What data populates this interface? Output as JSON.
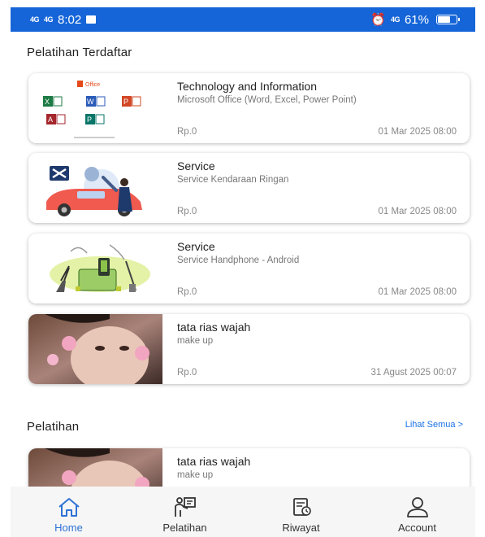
{
  "status": {
    "network1": "4G",
    "network2": "4G",
    "time": "8:02",
    "network3": "4G",
    "battery": "61%",
    "battery_level": 0.61
  },
  "registered": {
    "title": "Pelatihan Terdaftar",
    "items": [
      {
        "title": "Technology and Information",
        "subtitle": "Microsoft Office (Word, Excel, Power Point)",
        "price": "Rp.0",
        "date": "01 Mar 2025 08:00",
        "thumb": "office-logos",
        "brand": "Office"
      },
      {
        "title": "Service",
        "subtitle": "Service Kendaraan Ringan",
        "price": "Rp.0",
        "date": "01 Mar 2025 08:00",
        "thumb": "car-service"
      },
      {
        "title": "Service",
        "subtitle": "Service Handphone - Android",
        "price": "Rp.0",
        "date": "01 Mar 2025 08:00",
        "thumb": "phone-repair"
      },
      {
        "title": "tata rias wajah",
        "subtitle": "make up",
        "price": "Rp.0",
        "date": "31 Agust 2025 00:07",
        "thumb": "makeup-photo"
      }
    ]
  },
  "training": {
    "title": "Pelatihan",
    "see_all": "Lihat Semua >",
    "items": [
      {
        "title": "tata rias wajah",
        "subtitle": "make up",
        "thumb": "makeup-photo"
      }
    ]
  },
  "nav": {
    "items": [
      {
        "label": "Home",
        "icon": "home-icon",
        "active": true
      },
      {
        "label": "Pelatihan",
        "icon": "training-icon",
        "active": false
      },
      {
        "label": "Riwayat",
        "icon": "history-icon",
        "active": false
      },
      {
        "label": "Account",
        "icon": "account-icon",
        "active": false
      }
    ]
  },
  "colors": {
    "statusbar": "#1565d8",
    "accent": "#2f72d6",
    "link": "#1a73e8"
  }
}
